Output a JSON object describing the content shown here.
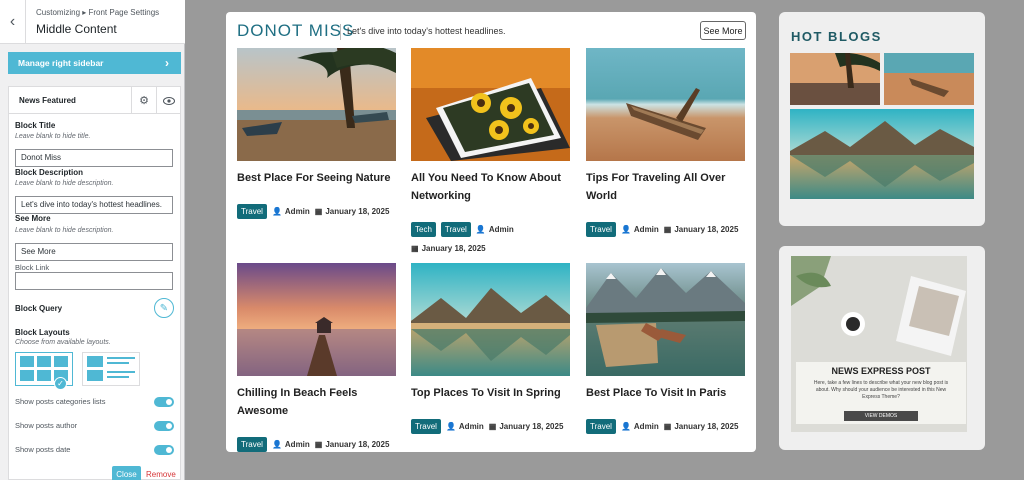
{
  "customizer": {
    "breadcrumb": "Customizing ▸ Front Page Settings",
    "section_title": "Middle Content",
    "manage_label": "Manage right sidebar",
    "block_name": "News Featured",
    "fields": {
      "title_label": "Block Title",
      "title_desc": "Leave blank to hide title.",
      "title_value": "Donot Miss",
      "description_label": "Block Description",
      "description_desc": "Leave blank to hide description.",
      "description_value": "Let's dive into today's hottest headlines.",
      "see_more_label": "See More",
      "see_more_desc": "Leave blank to hide description.",
      "see_more_value": "See More",
      "link_label": "Block Link",
      "link_value": "",
      "query_label": "Block Query",
      "layouts_label": "Block Layouts",
      "layouts_desc": "Choose from available layouts."
    },
    "toggles": [
      {
        "label": "Show posts categories lists",
        "on": true
      },
      {
        "label": "Show posts author",
        "on": true
      },
      {
        "label": "Show posts date",
        "on": true
      }
    ],
    "close_label": "Close",
    "remove_label": "Remove"
  },
  "preview": {
    "section_title": "DONOT MISS",
    "section_desc": "Let's dive into today's hottest headlines.",
    "see_more": "See More",
    "posts": [
      {
        "title": "Best Place For Seeing Nature",
        "tags": [
          "Travel"
        ],
        "author": "Admin",
        "date": "January 18, 2025"
      },
      {
        "title": "All You Need To Know About Networking",
        "tags": [
          "Tech",
          "Travel"
        ],
        "author": "Admin",
        "date": "January 18, 2025"
      },
      {
        "title": "Tips For Traveling All Over World",
        "tags": [
          "Travel"
        ],
        "author": "Admin",
        "date": "January 18, 2025"
      },
      {
        "title": "Chilling In Beach Feels Awesome",
        "tags": [
          "Travel"
        ],
        "author": "Admin",
        "date": "January 18, 2025"
      },
      {
        "title": "Top Places To Visit In Spring",
        "tags": [
          "Travel"
        ],
        "author": "Admin",
        "date": "January 18, 2025"
      },
      {
        "title": "Best Place To Visit In Paris",
        "tags": [
          "Travel"
        ],
        "author": "Admin",
        "date": "January 18, 2025"
      }
    ],
    "hot_blogs_title": "HOT BLOGS",
    "ad": {
      "title": "NEWS EXPRESS POST",
      "body": "Here, take a few lines to describe what your new blog post is about. Why should your audience be interested in this New Express Theme?",
      "button": "VIEW DEMOS"
    }
  },
  "colors": {
    "accent": "#4fb8d4",
    "tag": "#126c7a",
    "heading": "#1f6f83"
  }
}
